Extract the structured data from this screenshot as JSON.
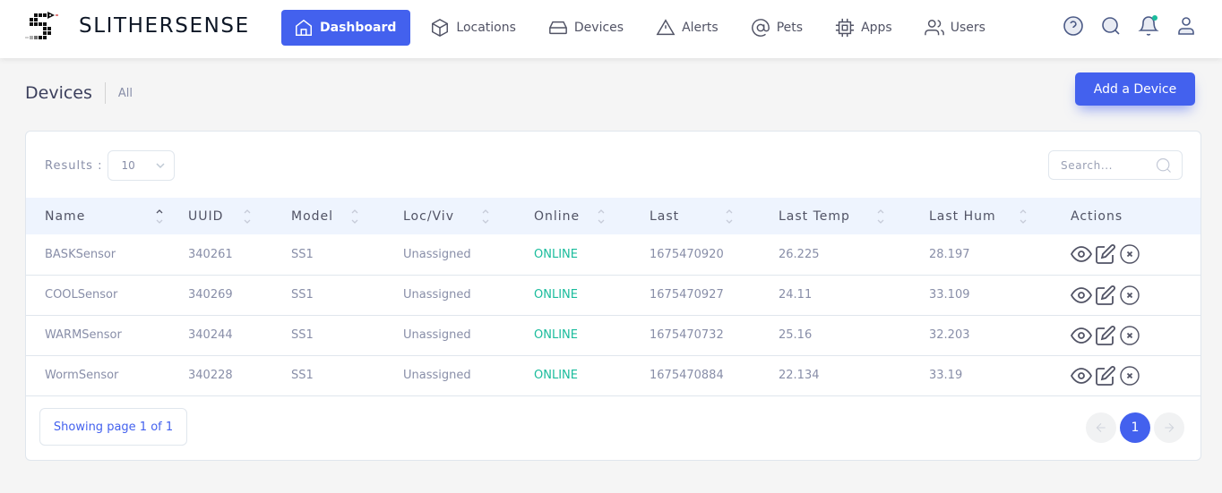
{
  "app": {
    "brand": "SLITHERSENSE"
  },
  "nav": {
    "items": [
      {
        "label": "Dashboard",
        "icon": "home-icon",
        "active": true
      },
      {
        "label": "Locations",
        "icon": "cube-icon"
      },
      {
        "label": "Devices",
        "icon": "hard-drive-icon"
      },
      {
        "label": "Alerts",
        "icon": "alert-triangle-icon"
      },
      {
        "label": "Pets",
        "icon": "at-sign-icon"
      },
      {
        "label": "Apps",
        "icon": "cpu-icon"
      },
      {
        "label": "Users",
        "icon": "users-icon"
      }
    ],
    "right_icons": [
      "help-icon",
      "search-icon",
      "bell-icon",
      "user-icon"
    ],
    "notification_dot_color": "#1abc9c"
  },
  "page": {
    "title": "Devices",
    "subtitle": "All",
    "add_button": "Add a Device"
  },
  "controls": {
    "results_label": "Results :",
    "results_value": "10",
    "search_placeholder": "Search...",
    "search_value": ""
  },
  "table": {
    "columns": [
      "Name",
      "UUID",
      "Model",
      "Loc/Viv",
      "Online",
      "Last",
      "Last Temp",
      "Last Hum",
      "Actions"
    ],
    "sorted_column": "Name",
    "sort_direction": "asc",
    "rows": [
      {
        "name": "BASKSensor",
        "uuid": "340261",
        "model": "SS1",
        "loc": "Unassigned",
        "online": "ONLINE",
        "last": "1675470920",
        "temp": "26.225",
        "hum": "28.197"
      },
      {
        "name": "COOLSensor",
        "uuid": "340269",
        "model": "SS1",
        "loc": "Unassigned",
        "online": "ONLINE",
        "last": "1675470927",
        "temp": "24.11",
        "hum": "33.109"
      },
      {
        "name": "WARMSensor",
        "uuid": "340244",
        "model": "SS1",
        "loc": "Unassigned",
        "online": "ONLINE",
        "last": "1675470732",
        "temp": "25.16",
        "hum": "32.203"
      },
      {
        "name": "WormSensor",
        "uuid": "340228",
        "model": "SS1",
        "loc": "Unassigned",
        "online": "ONLINE",
        "last": "1675470884",
        "temp": "22.134",
        "hum": "33.19"
      }
    ],
    "row_actions": [
      "view-icon",
      "edit-icon",
      "delete-icon"
    ]
  },
  "pagination": {
    "showing": "Showing page 1 of 1",
    "current_page": "1",
    "prev_icon": "arrow-left-icon",
    "next_icon": "arrow-right-icon"
  },
  "colors": {
    "primary": "#4361ee",
    "online": "#1abc9c",
    "header_bg": "#eef4fe"
  }
}
